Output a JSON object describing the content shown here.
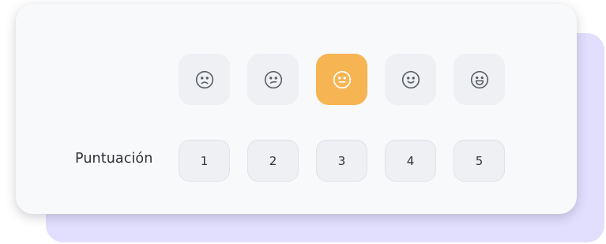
{
  "colors": {
    "back_card": "#e1dffd",
    "card": "#f8f9fb",
    "selected": "#f7b452",
    "button_bg": "#eef0f4",
    "icon": "#5a5f68"
  },
  "faces": [
    {
      "icon": "very-sad-face-icon",
      "selected": false
    },
    {
      "icon": "sad-face-icon",
      "selected": false
    },
    {
      "icon": "neutral-face-icon",
      "selected": true
    },
    {
      "icon": "smile-face-icon",
      "selected": false
    },
    {
      "icon": "laugh-face-icon",
      "selected": false
    }
  ],
  "rating": {
    "label": "Puntuación",
    "options": [
      "1",
      "2",
      "3",
      "4",
      "5"
    ]
  }
}
